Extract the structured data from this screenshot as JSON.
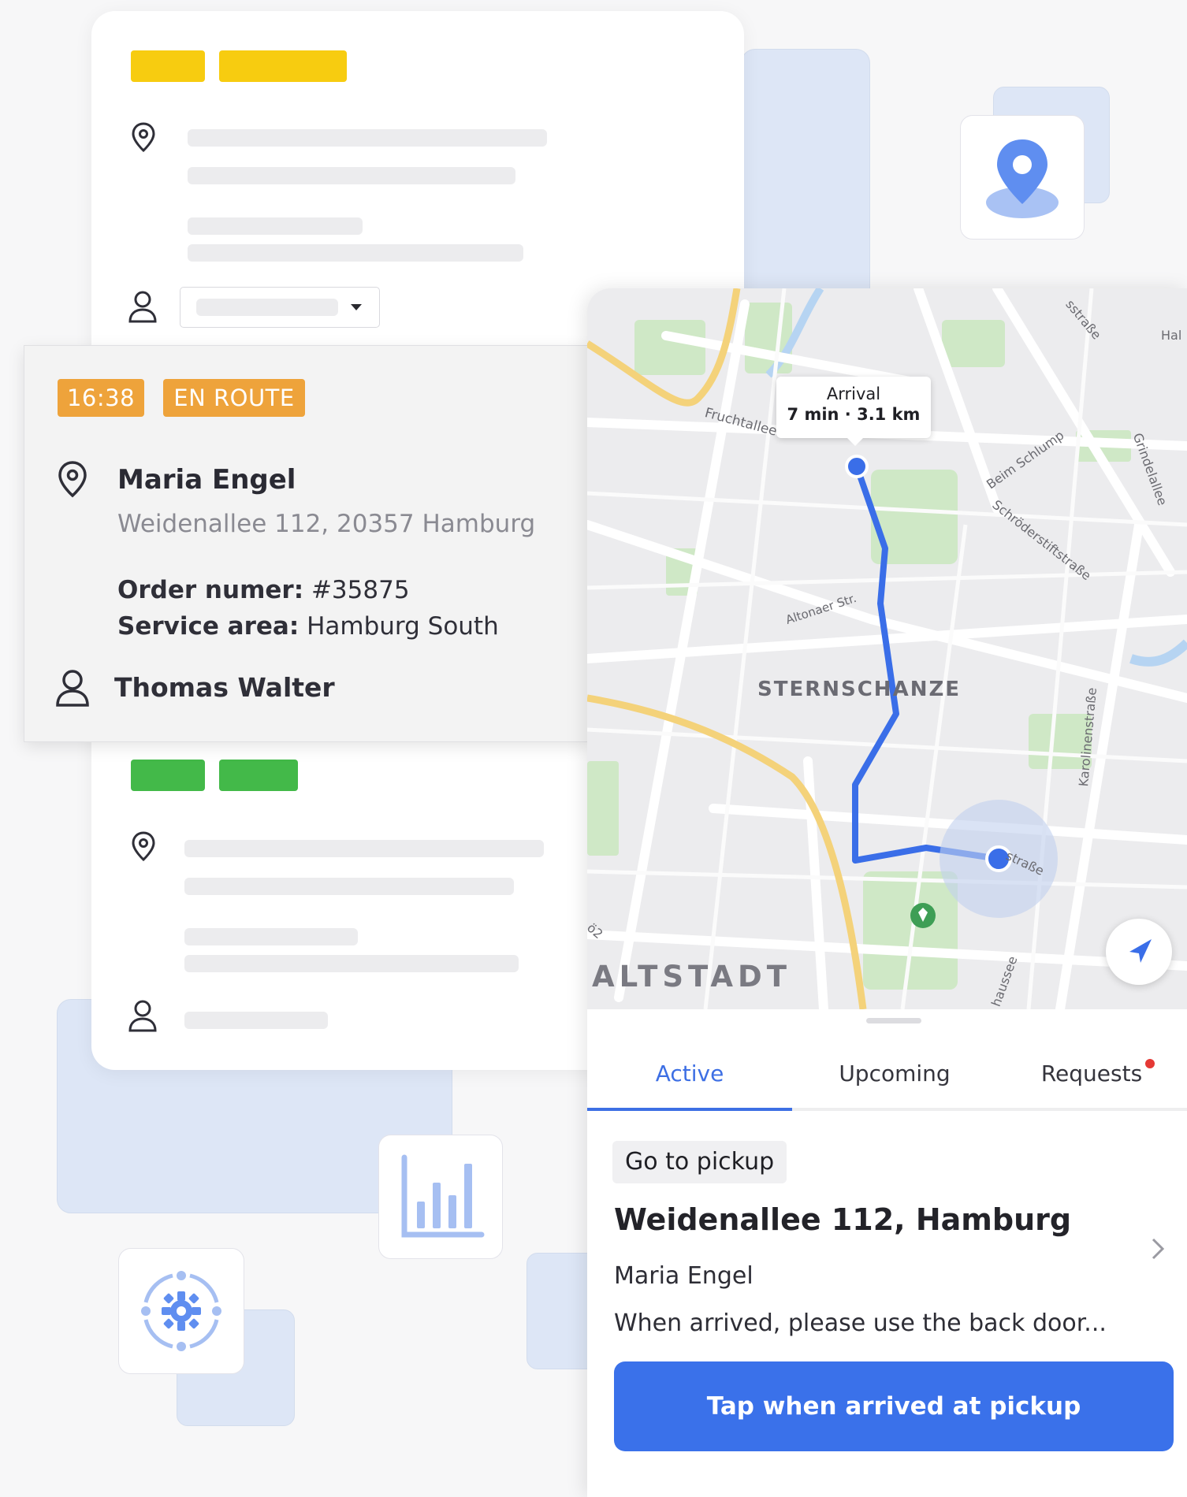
{
  "background_card_top": {
    "pin_icon": "map-pin-icon",
    "user_icon": "user-icon",
    "dropdown_icon": "caret-down-icon"
  },
  "task_card": {
    "time": "16:38",
    "status": "EN ROUTE",
    "customer_name": "Maria Engel",
    "address": "Weidenallee 112, 20357 Hamburg",
    "order_label": "Order numer:",
    "order_value": "#35875",
    "service_label": "Service area:",
    "service_value": "Hamburg South",
    "driver_name": "Thomas Walter",
    "colors": {
      "tag": "#eea33b"
    }
  },
  "map": {
    "tooltip_title": "Arrival",
    "tooltip_eta": "7 min · 3.1 km",
    "district_1": "STERNSCHANZE",
    "district_2": "ALTSTADT",
    "streets": [
      "Fruchtallee",
      "Altonaer Str.",
      "Beim Schlump",
      "Schröderstiftstraße",
      "Grindelallee",
      "Karolinenstraße",
      "straße",
      "Hal",
      "sstraße",
      "haussee",
      "ö2"
    ],
    "route_color": "#3a6ee8",
    "locate_icon": "navigation-arrow-icon"
  },
  "tabs": [
    {
      "label": "Active",
      "active": true
    },
    {
      "label": "Upcoming",
      "active": false
    },
    {
      "label": "Requests",
      "active": false,
      "badge": true
    }
  ],
  "job": {
    "chip": "Go to pickup",
    "address": "Weidenallee 112, Hamburg",
    "customer": "Maria Engel",
    "note": "When arrived, please use the back door...",
    "button": "Tap when arrived at pickup"
  },
  "decor_icons": {
    "top_right": "location-pin-icon",
    "middle": "bar-chart-icon",
    "bottom_left": "gear-sync-icon"
  },
  "colors": {
    "accent": "#3a71ea",
    "pill_yellow": "#f7cc10",
    "pill_green": "#43b949",
    "badge_red": "#e53935"
  }
}
